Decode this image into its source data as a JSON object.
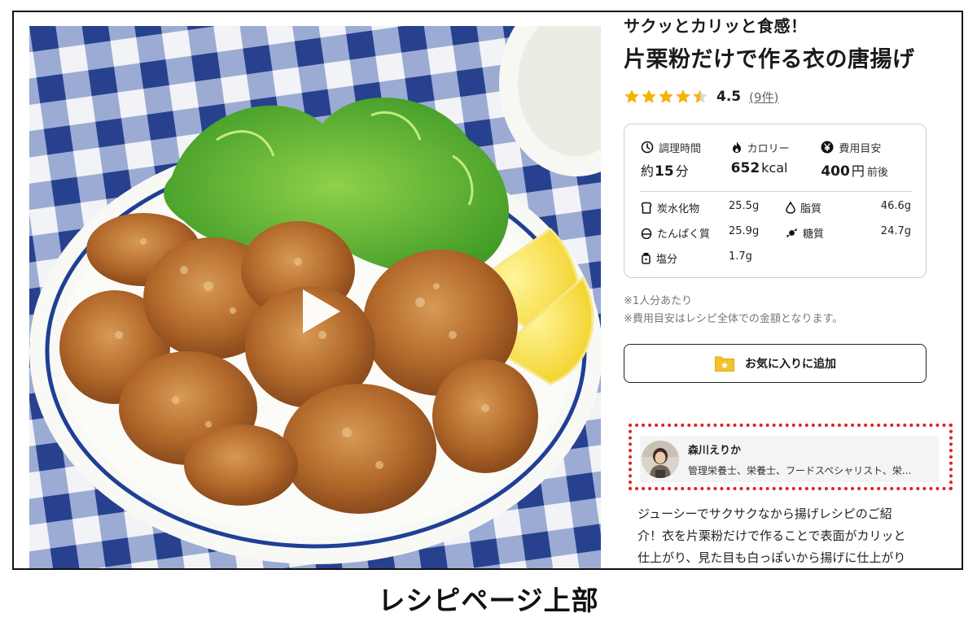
{
  "recipe": {
    "subtitle": "サクッとカリッと食感！",
    "title": "片栗粉だけで作る衣の唐揚げ",
    "rating": {
      "value": "4.5",
      "stars": 4.5,
      "count_label": "(9件)"
    },
    "media": {
      "image": "karaage-plate-photo",
      "play_icon": "play-icon"
    }
  },
  "nutrition": {
    "time": {
      "label": "調理時間",
      "prefix": "約",
      "value": "15",
      "unit": "分",
      "icon": "clock-icon"
    },
    "calorie": {
      "label": "カロリー",
      "value": "652",
      "unit": "kcal",
      "icon": "flame-icon"
    },
    "cost": {
      "label": "費用目安",
      "value": "400",
      "unit": "円",
      "suffix": "前後",
      "icon": "yen-icon"
    },
    "items": [
      {
        "label": "炭水化物",
        "value": "25.5g",
        "icon": "bread-icon"
      },
      {
        "label": "脂質",
        "value": "46.6g",
        "icon": "drop-icon"
      },
      {
        "label": "たんぱく質",
        "value": "25.9g",
        "icon": "egg-icon"
      },
      {
        "label": "糖質",
        "value": "24.7g",
        "icon": "candy-icon"
      },
      {
        "label": "塩分",
        "value": "1.7g",
        "icon": "salt-icon"
      }
    ]
  },
  "notes": {
    "per_serving": "※1人分あたり",
    "cost_note": "※費用目安はレシピ全体での金額となります。"
  },
  "favorite": {
    "label": "お気に入りに追加",
    "icon": "folder-star-icon"
  },
  "author": {
    "name": "森川えりか",
    "description": "管理栄養士、栄養士、フードスペシャリスト、栄..."
  },
  "description": {
    "lines": [
      "ジューシーでサクサクなから揚げレシピのご紹",
      "介！衣を片栗粉だけで作ることで表面がカリッと",
      "仕上がり、見た目も白っぽいから揚げに仕上がり"
    ]
  },
  "caption": "レシピページ上部",
  "colors": {
    "star": "#f5b301",
    "highlight": "#e0201d",
    "folder": "#f2c230"
  }
}
